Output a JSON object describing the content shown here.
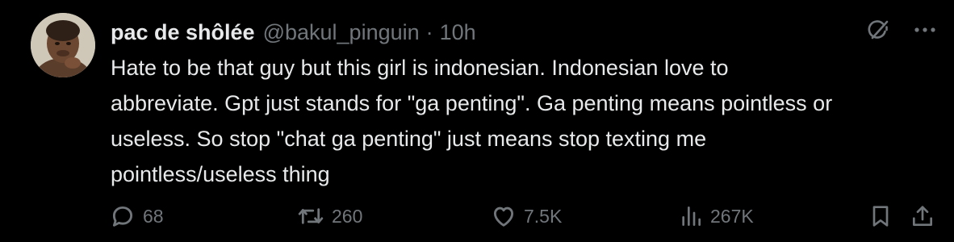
{
  "tweet": {
    "author_name": "pac de shôlée",
    "handle": "@bakul_pinguin",
    "separator": "·",
    "time": "10h",
    "text": "Hate to be that guy but this girl is indonesian. Indonesian love to\nabbreviate. Gpt just stands for \"ga penting\". Ga penting means pointless or\nuseless. So stop \"chat ga penting\" just means stop texting me\npointless/useless thing"
  },
  "actions": {
    "replies": "68",
    "reposts": "260",
    "likes": "7.5K",
    "views": "267K"
  },
  "icons": {
    "top": [
      "grok-icon",
      "more-icon"
    ],
    "actions": [
      "reply-icon",
      "repost-icon",
      "like-icon",
      "views-icon",
      "bookmark-icon",
      "share-icon"
    ]
  },
  "colors": {
    "background": "#000000",
    "primary_text": "#e7e9ea",
    "secondary_text": "#71767b"
  }
}
